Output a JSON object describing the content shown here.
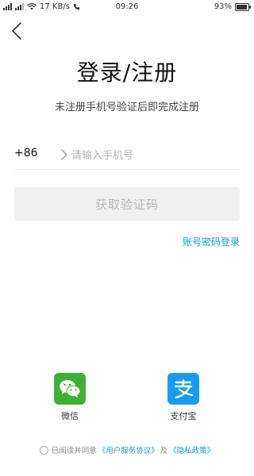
{
  "status_bar": {
    "speed": "17 KB/s",
    "time": "09:26",
    "battery_percent": "93%",
    "battery_level": 0.93
  },
  "title": "登录/注册",
  "subtitle": "未注册手机号验证后即完成注册",
  "phone": {
    "country_code": "+86",
    "placeholder": "请输入手机号",
    "value": ""
  },
  "get_code_label": "获取验证码",
  "password_login_label": "账号密码登录",
  "social": {
    "wechat_label": "微信",
    "alipay_label": "支付宝"
  },
  "agreement": {
    "prefix": "已阅读并同意",
    "user_agreement": "《用户服务协议》",
    "and": "及",
    "privacy_policy": "《隐私政策》"
  },
  "colors": {
    "link": "#18a0c7",
    "wechat": "#3cb034",
    "alipay": "#1a9bf0",
    "button_disabled_bg": "#f0f0f0"
  }
}
